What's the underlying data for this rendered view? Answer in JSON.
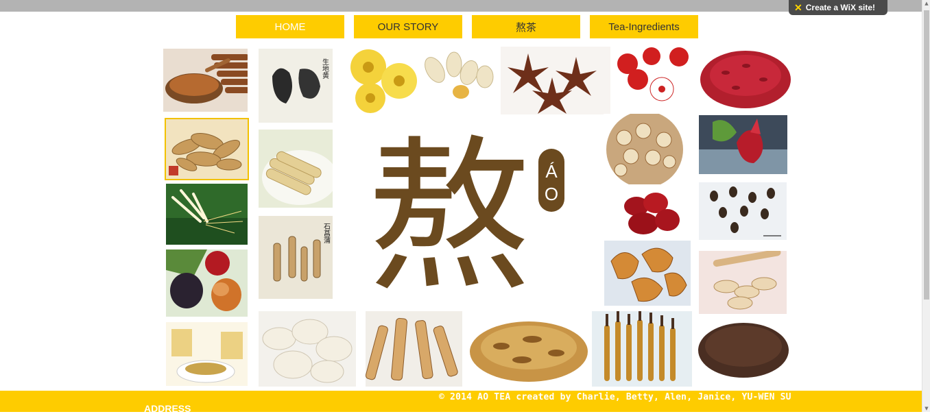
{
  "wix_banner": {
    "label": "Create a WiX site!"
  },
  "nav": {
    "home": "HOME",
    "our_story": "OUR STORY",
    "ao_cha": "熬茶",
    "tea_ingredients": "Tea-Ingredients"
  },
  "logo": {
    "glyph": "熬",
    "roman_top": "Á",
    "roman_bottom": "O"
  },
  "herb_labels": {
    "sheng_di_huang": "生地黄",
    "shi_chang_pu": "石菖蒲"
  },
  "footer": {
    "copyright": "© 2014 AO TEA created by  Charlie, Betty, Alen,  Janice, YU-WEN SU",
    "address": "ADDRESS"
  },
  "colors": {
    "accent": "#fecc00",
    "logo_brown": "#6b4a1f",
    "topbar": "#b3b3b3"
  }
}
